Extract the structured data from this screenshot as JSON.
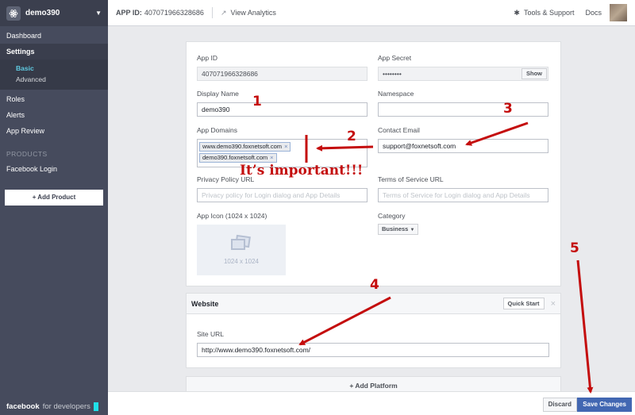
{
  "sidebar": {
    "app_name": "demo390",
    "items": [
      {
        "label": "Dashboard"
      },
      {
        "label": "Settings"
      },
      {
        "label": "Roles"
      },
      {
        "label": "Alerts"
      },
      {
        "label": "App Review"
      }
    ],
    "settings_sub": [
      {
        "label": "Basic"
      },
      {
        "label": "Advanced"
      }
    ],
    "products_title": "PRODUCTS",
    "products": [
      {
        "label": "Facebook Login"
      }
    ],
    "add_product": "+ Add Product",
    "footer_brand": "facebook",
    "footer_suffix": "for developers"
  },
  "topbar": {
    "app_id_label": "APP ID:",
    "app_id_value": "407071966328686",
    "view_analytics": "View Analytics",
    "tools_support": "Tools & Support",
    "docs": "Docs"
  },
  "basic": {
    "app_id": {
      "label": "App ID",
      "value": "407071966328686"
    },
    "app_secret": {
      "label": "App Secret",
      "value": "••••••••",
      "show": "Show"
    },
    "display_name": {
      "label": "Display Name",
      "value": "demo390"
    },
    "namespace": {
      "label": "Namespace",
      "value": ""
    },
    "app_domains": {
      "label": "App Domains",
      "tags": [
        "www.demo390.foxnetsoft.com",
        "demo390.foxnetsoft.com"
      ]
    },
    "contact_email": {
      "label": "Contact Email",
      "value": "support@foxnetsoft.com"
    },
    "privacy_url": {
      "label": "Privacy Policy URL",
      "placeholder": "Privacy policy for Login dialog and App Details"
    },
    "tos_url": {
      "label": "Terms of Service URL",
      "placeholder": "Terms of Service for Login dialog and App Details"
    },
    "app_icon": {
      "label": "App Icon (1024 x 1024)",
      "size_text": "1024 x 1024"
    },
    "category": {
      "label": "Category",
      "value": "Business"
    }
  },
  "website": {
    "title": "Website",
    "quick_start": "Quick Start",
    "close": "×",
    "site_url": {
      "label": "Site URL",
      "value": "http://www.demo390.foxnetsoft.com/"
    }
  },
  "add_platform": "+ Add Platform",
  "footer": {
    "discard": "Discard",
    "save": "Save Changes"
  },
  "annotations": {
    "n1": "1",
    "n2": "2",
    "n3": "3",
    "n4": "4",
    "n5": "5",
    "important": "It’s important!!!",
    "color": "#c40d0d"
  },
  "icons": {
    "caret": "▼",
    "analytics": "↗",
    "bug": "✱"
  }
}
